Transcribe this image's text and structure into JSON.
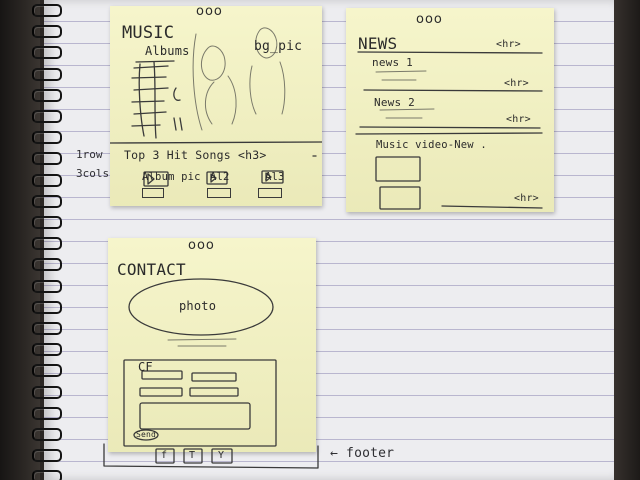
{
  "margin": {
    "row_note": "1row",
    "cols_note": "3cols"
  },
  "music_note": {
    "menu_dots": "ooo",
    "title": "MUSIC",
    "albums_label": "Albums",
    "bg_label": "bg_pic",
    "hit_songs_heading": "Top 3 Hit Songs <h3>",
    "album_cells": [
      "Album pic",
      "Al2",
      "Al3"
    ]
  },
  "news_note": {
    "menu_dots": "ooo",
    "title": "NEWS",
    "hr_tags": [
      "<hr>",
      "<hr>",
      "<hr>",
      "<hr>"
    ],
    "items": [
      "news 1",
      "News 2"
    ],
    "video_label": "Music video-New ."
  },
  "contact_note": {
    "menu_dots": "ooo",
    "title": "CONTACT",
    "photo_label": "photo",
    "form_label": "CF",
    "send_label": "Send",
    "footer_icons": [
      "f",
      "T",
      "Y"
    ]
  },
  "footer_annotation": "← footer"
}
